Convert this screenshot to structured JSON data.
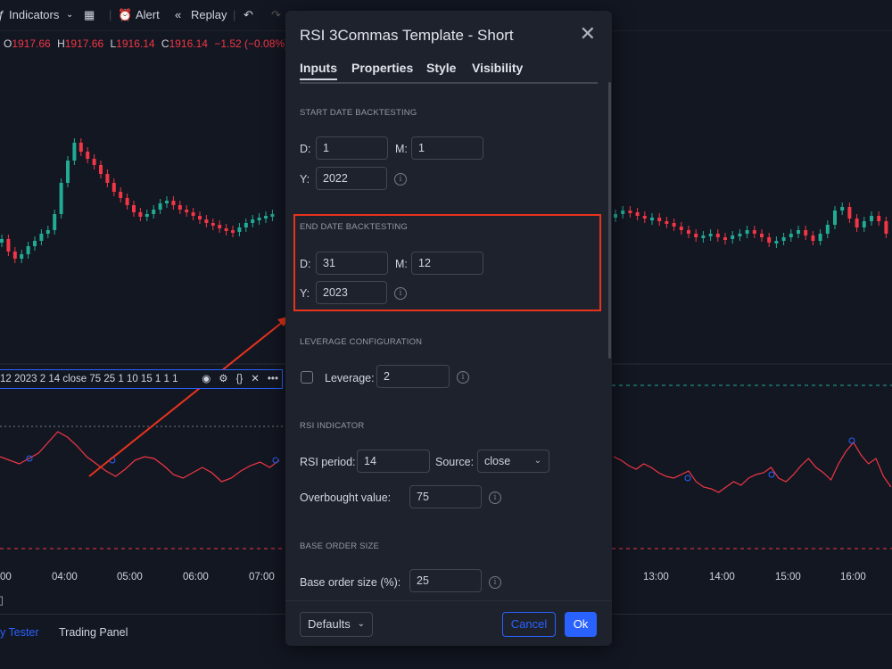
{
  "toolbar": {
    "indicators_label": "Indicators",
    "alert_label": "Alert",
    "replay_label": "Replay"
  },
  "ohlc": {
    "o_key": "O",
    "o_val": "1917.66",
    "h_key": "H",
    "h_val": "1917.66",
    "l_key": "L",
    "l_val": "1916.14",
    "c_key": "C",
    "c_val": "1916.14",
    "change": "−1.52 (−0.08%)"
  },
  "indicator_legend": "12 2023 2 14 close 75 25 1 10 15 1 1 1",
  "time_axis": [
    "00",
    "04:00",
    "05:00",
    "06:00",
    "07:00",
    "13:00",
    "14:00",
    "15:00",
    "16:00"
  ],
  "bottom_tabs": {
    "strategy_tester": "y Tester",
    "trading_panel": "Trading Panel"
  },
  "dialog": {
    "title": "RSI 3Commas Template - Short",
    "tabs": [
      "Inputs",
      "Properties",
      "Style",
      "Visibility"
    ],
    "start_section": "START DATE BACKTESTING",
    "start": {
      "d_label": "D:",
      "d": "1",
      "m_label": "M:",
      "m": "1",
      "y_label": "Y:",
      "y": "2022"
    },
    "end_section": "END DATE BACKTESTING",
    "end": {
      "d_label": "D:",
      "d": "31",
      "m_label": "M:",
      "m": "12",
      "y_label": "Y:",
      "y": "2023"
    },
    "leverage_section": "LEVERAGE CONFIGURATION",
    "leverage_label": "Leverage:",
    "leverage": "2",
    "rsi_section": "RSI INDICATOR",
    "rsi_period_label": "RSI period:",
    "rsi_period": "14",
    "source_label": "Source:",
    "source": "close",
    "overbought_label": "Overbought value:",
    "overbought": "75",
    "base_section": "BASE ORDER SIZE",
    "base_label": "Base order size (%):",
    "base": "25",
    "defaults_label": "Defaults",
    "cancel_label": "Cancel",
    "ok_label": "Ok"
  },
  "colors": {
    "accent": "#2962ff",
    "up": "#22ab94",
    "down": "#f23645",
    "highlight": "#e8331c"
  }
}
